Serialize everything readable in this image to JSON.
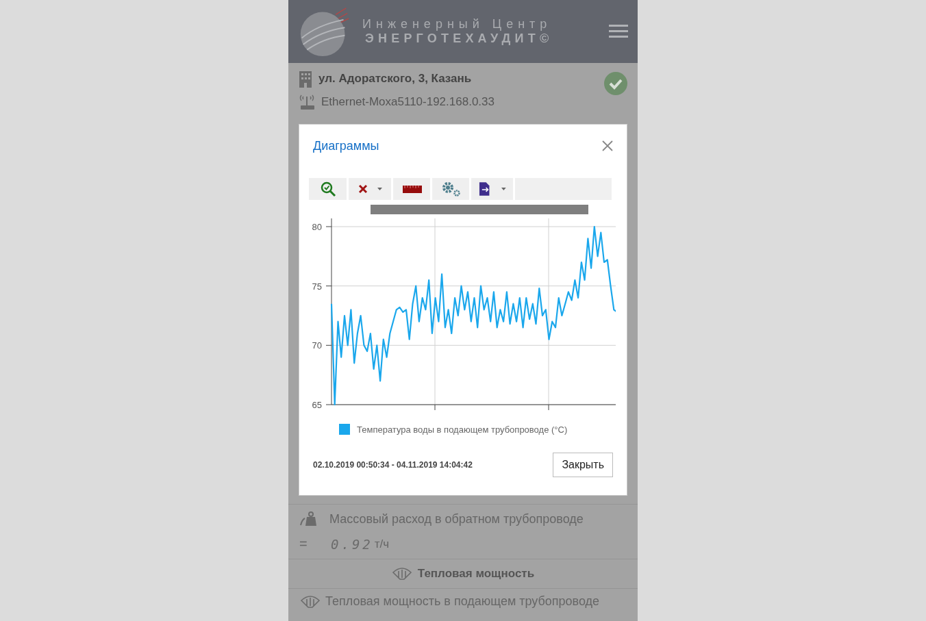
{
  "header": {
    "logo_line1": "Инженерный Центр",
    "logo_line2": "ЭНЕРГОТЕХАУДИТ©"
  },
  "object": {
    "address": "ул. Адоратского, 3, Казань",
    "connection": "Ethernet-Moxa5110-192.168.0.33",
    "online": true
  },
  "modal": {
    "title": "Диаграммы",
    "toolbar": [
      {
        "kind": "zoom",
        "dropdown": false
      },
      {
        "kind": "clear",
        "dropdown": true
      },
      {
        "kind": "ruler",
        "dropdown": false
      },
      {
        "kind": "settings",
        "dropdown": false
      },
      {
        "kind": "export",
        "dropdown": true
      }
    ],
    "chart_data": {
      "type": "line",
      "grid": true,
      "ylim": [
        65,
        80
      ],
      "yticks": [
        65,
        70,
        75,
        80
      ],
      "series": [
        {
          "name": "Температура воды в подающем трубопроводе  (°C)",
          "color": "#1aa7ec",
          "values": [
            73.5,
            65,
            72,
            69,
            72.5,
            70,
            73,
            68.5,
            71,
            72.5,
            70,
            69.5,
            71,
            68,
            70,
            67,
            70.5,
            69,
            71,
            72,
            73,
            73.2,
            72.8,
            73,
            70.5,
            73.5,
            75,
            72,
            74,
            73,
            75.5,
            71,
            74,
            72,
            76,
            71.5,
            73,
            71,
            74,
            72.5,
            75,
            73,
            74.5,
            72,
            74,
            71.5,
            75,
            73,
            74,
            72,
            74.5,
            71.5,
            73,
            72,
            74.5,
            71.8,
            73.5,
            72,
            74,
            71.5,
            74,
            72.2,
            73.5,
            71.8,
            74.8,
            72.5,
            73,
            70.5,
            72,
            71.5,
            74,
            72.5,
            73.5,
            74.5,
            73.8,
            75.5,
            74,
            77,
            75.5,
            79,
            76.5,
            80,
            77.5,
            79.5,
            77,
            77.2,
            75,
            73,
            72.8
          ]
        }
      ]
    },
    "period": "02.10.2019 00:50:34 - 04.11.2019 14:04:42",
    "close_button": "Закрыть"
  },
  "rows": [
    {
      "kind": "measure",
      "label": "Массовый расход в обратном трубопроводе",
      "sign": "=",
      "value": "0.92",
      "unit": "т/ч"
    },
    {
      "kind": "section",
      "label": "Тепловая мощность"
    },
    {
      "kind": "item",
      "label": "Тепловая мощность в подающем трубопроводе"
    }
  ]
}
